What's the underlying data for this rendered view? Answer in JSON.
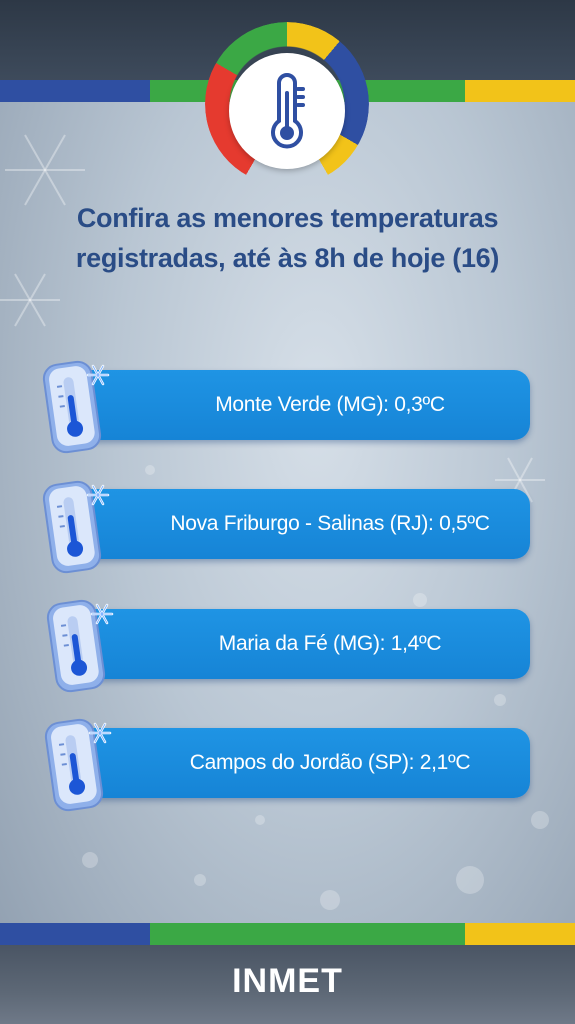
{
  "header": {
    "icon": "thermometer-icon"
  },
  "title": {
    "line1": "Confira as menores temperaturas",
    "line2": "registradas, até às 8h de hoje (16)"
  },
  "readings": [
    {
      "label": "Monte Verde (MG): 0,3ºC",
      "icon": "cold-thermometer-icon"
    },
    {
      "label": "Nova Friburgo - Salinas (RJ): 0,5ºC",
      "icon": "cold-thermometer-icon"
    },
    {
      "label": "Maria da Fé (MG): 1,4ºC",
      "icon": "cold-thermometer-icon"
    },
    {
      "label": "Campos do Jordão (SP): 2,1ºC",
      "icon": "cold-thermometer-icon"
    }
  ],
  "footer": {
    "brand": "INMET"
  },
  "colors": {
    "title": "#2a4c86",
    "pill": "#1a8ddd",
    "stripe_blue": "#2f4fa2",
    "stripe_green": "#3ba845",
    "stripe_yellow": "#f2c319",
    "ring_red": "#e53a2f"
  }
}
